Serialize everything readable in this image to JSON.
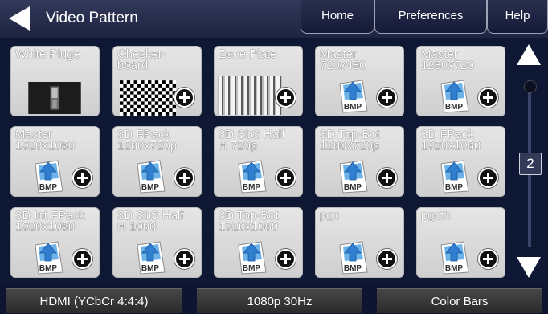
{
  "header": {
    "title": "Video Pattern",
    "tabs": [
      {
        "label": "Home"
      },
      {
        "label": "Preferences"
      },
      {
        "label": "Help"
      }
    ]
  },
  "tiles": [
    {
      "line1": "White Pluge",
      "line2": "",
      "kind": "pluge",
      "plus": false
    },
    {
      "line1": "Checker-",
      "line2": "board",
      "kind": "checker",
      "plus": true
    },
    {
      "line1": "Zone Plate",
      "line2": "",
      "kind": "zone",
      "plus": true
    },
    {
      "line1": "Master",
      "line2": "720x480",
      "kind": "bmp",
      "plus": true
    },
    {
      "line1": "Master",
      "line2": "1280x720",
      "kind": "bmp",
      "plus": true
    },
    {
      "line1": "Master",
      "line2": "1920x1080",
      "kind": "bmp",
      "plus": true
    },
    {
      "line1": "3D FPack",
      "line2": "1280x720p",
      "kind": "bmp",
      "plus": true
    },
    {
      "line1": "3D SbS Half",
      "line2": "H 720p",
      "kind": "bmp",
      "plus": true
    },
    {
      "line1": "3D Top-Bot",
      "line2": "1280x720p",
      "kind": "bmp",
      "plus": true
    },
    {
      "line1": "3D FPack",
      "line2": "1920x1080",
      "kind": "bmp",
      "plus": true
    },
    {
      "line1": "3D Int FPack",
      "line2": "1920x1080",
      "kind": "bmp",
      "plus": true
    },
    {
      "line1": "3D SbS Half",
      "line2": "H 1080",
      "kind": "bmp",
      "plus": true
    },
    {
      "line1": "3D Top-Bot",
      "line2": "1920x1080",
      "kind": "bmp",
      "plus": true
    },
    {
      "line1": "pgc",
      "line2": "",
      "kind": "bmp",
      "plus": true
    },
    {
      "line1": "pgcfh",
      "line2": "",
      "kind": "bmp",
      "plus": true
    }
  ],
  "scroll": {
    "page": "2"
  },
  "status": {
    "interface": "HDMI (YCbCr 4:4:4)",
    "format": "1080p 30Hz",
    "pattern": "Color Bars"
  },
  "icons": {
    "back": "back-arrow-icon",
    "up": "scroll-up-arrow-icon",
    "down": "scroll-down-arrow-icon",
    "add": "plus-circle-icon",
    "bmp": "bmp-file-icon"
  }
}
